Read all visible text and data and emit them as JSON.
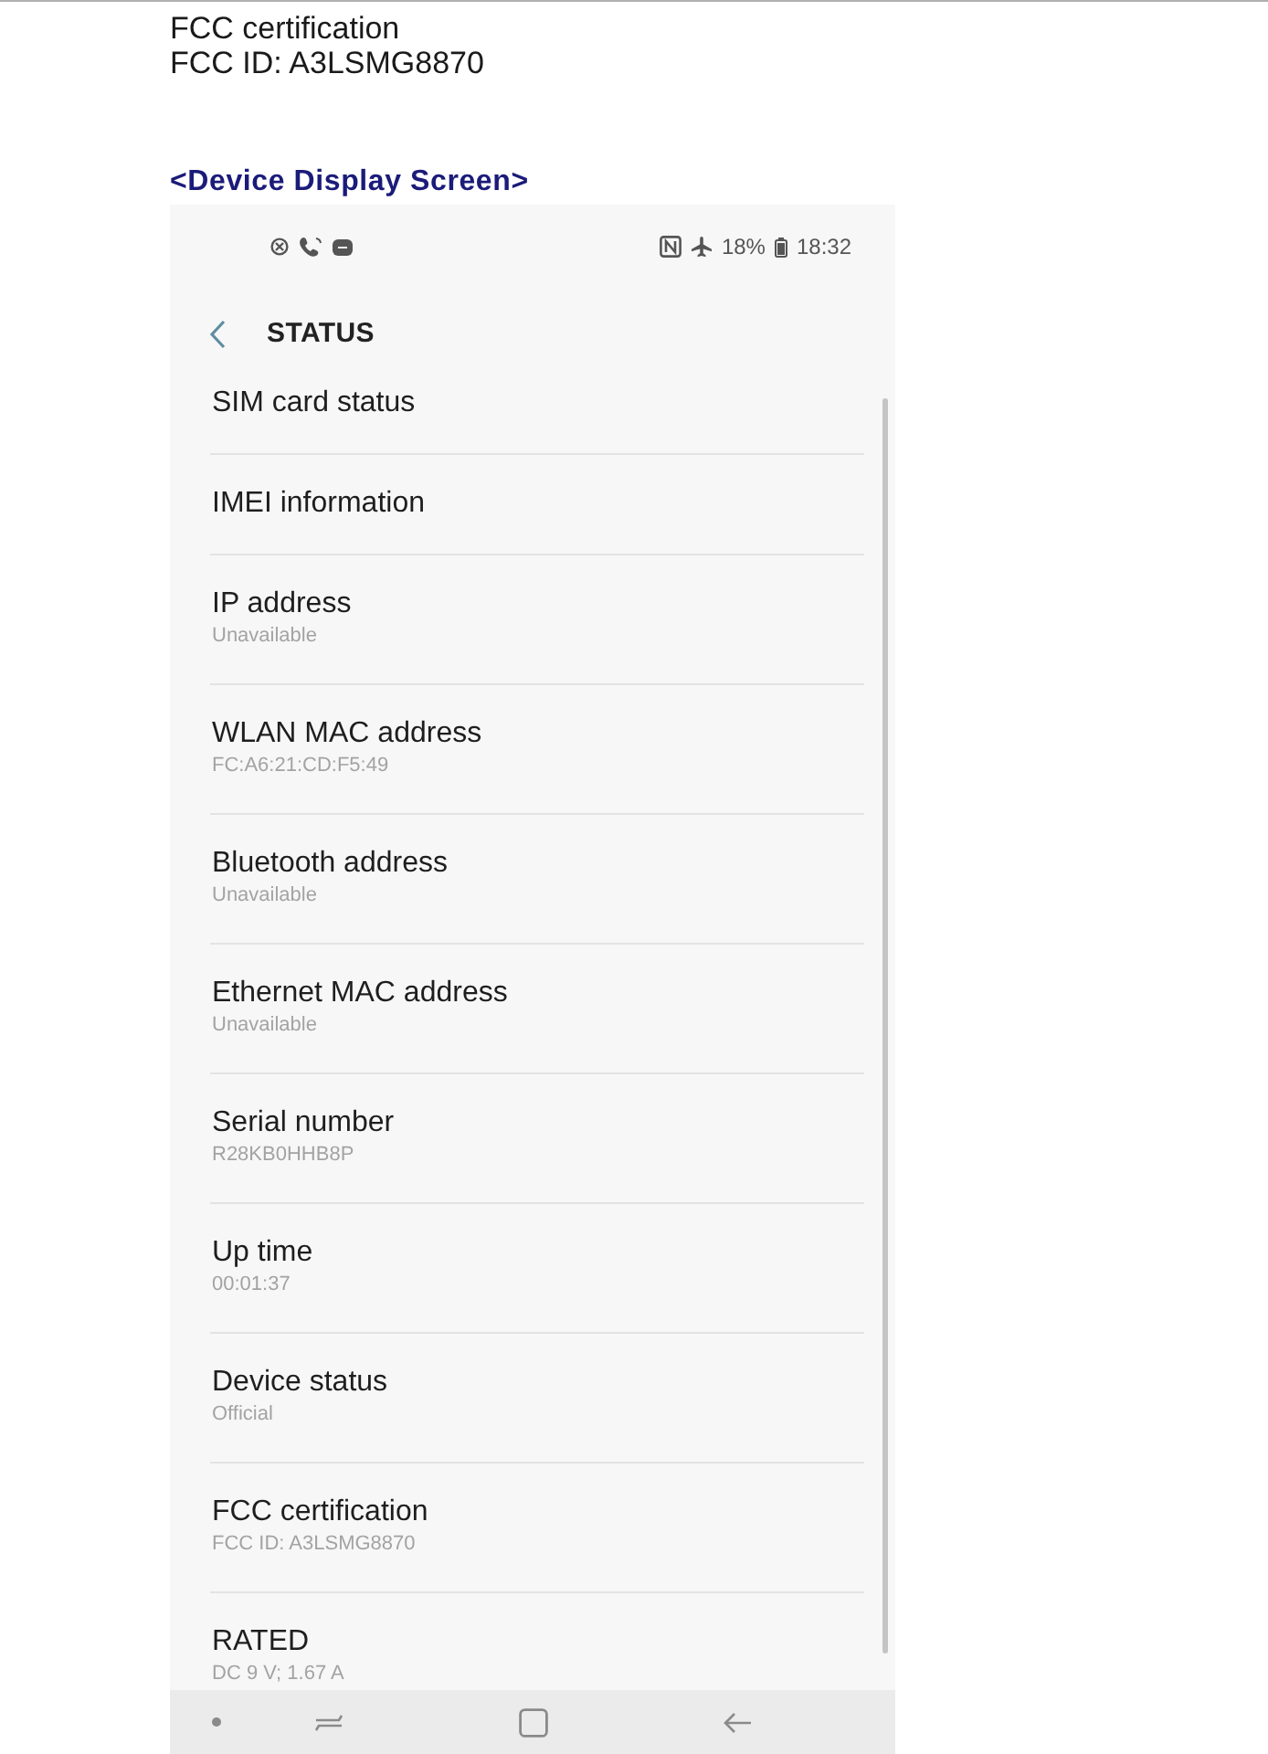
{
  "document": {
    "lines": [
      "FCC certification",
      "FCC ID: A3LSMG8870"
    ],
    "caption": "<Device Display Screen>"
  },
  "status_bar": {
    "battery": "18%",
    "time": "18:32"
  },
  "header": {
    "title": "STATUS"
  },
  "items": [
    {
      "title": "SIM card status"
    },
    {
      "title": "IMEI information"
    },
    {
      "title": "IP address",
      "subtitle": "Unavailable"
    },
    {
      "title": "WLAN MAC address",
      "subtitle": "FC:A6:21:CD:F5:49"
    },
    {
      "title": "Bluetooth address",
      "subtitle": "Unavailable"
    },
    {
      "title": "Ethernet MAC address",
      "subtitle": "Unavailable"
    },
    {
      "title": "Serial number",
      "subtitle": "R28KB0HHB8P"
    },
    {
      "title": "Up time",
      "subtitle": "00:01:37"
    },
    {
      "title": "Device status",
      "subtitle": "Official"
    },
    {
      "title": "FCC certification",
      "subtitle": "FCC ID: A3LSMG8870"
    },
    {
      "title": "RATED",
      "subtitle": "DC 9 V; 1.67 A"
    }
  ]
}
